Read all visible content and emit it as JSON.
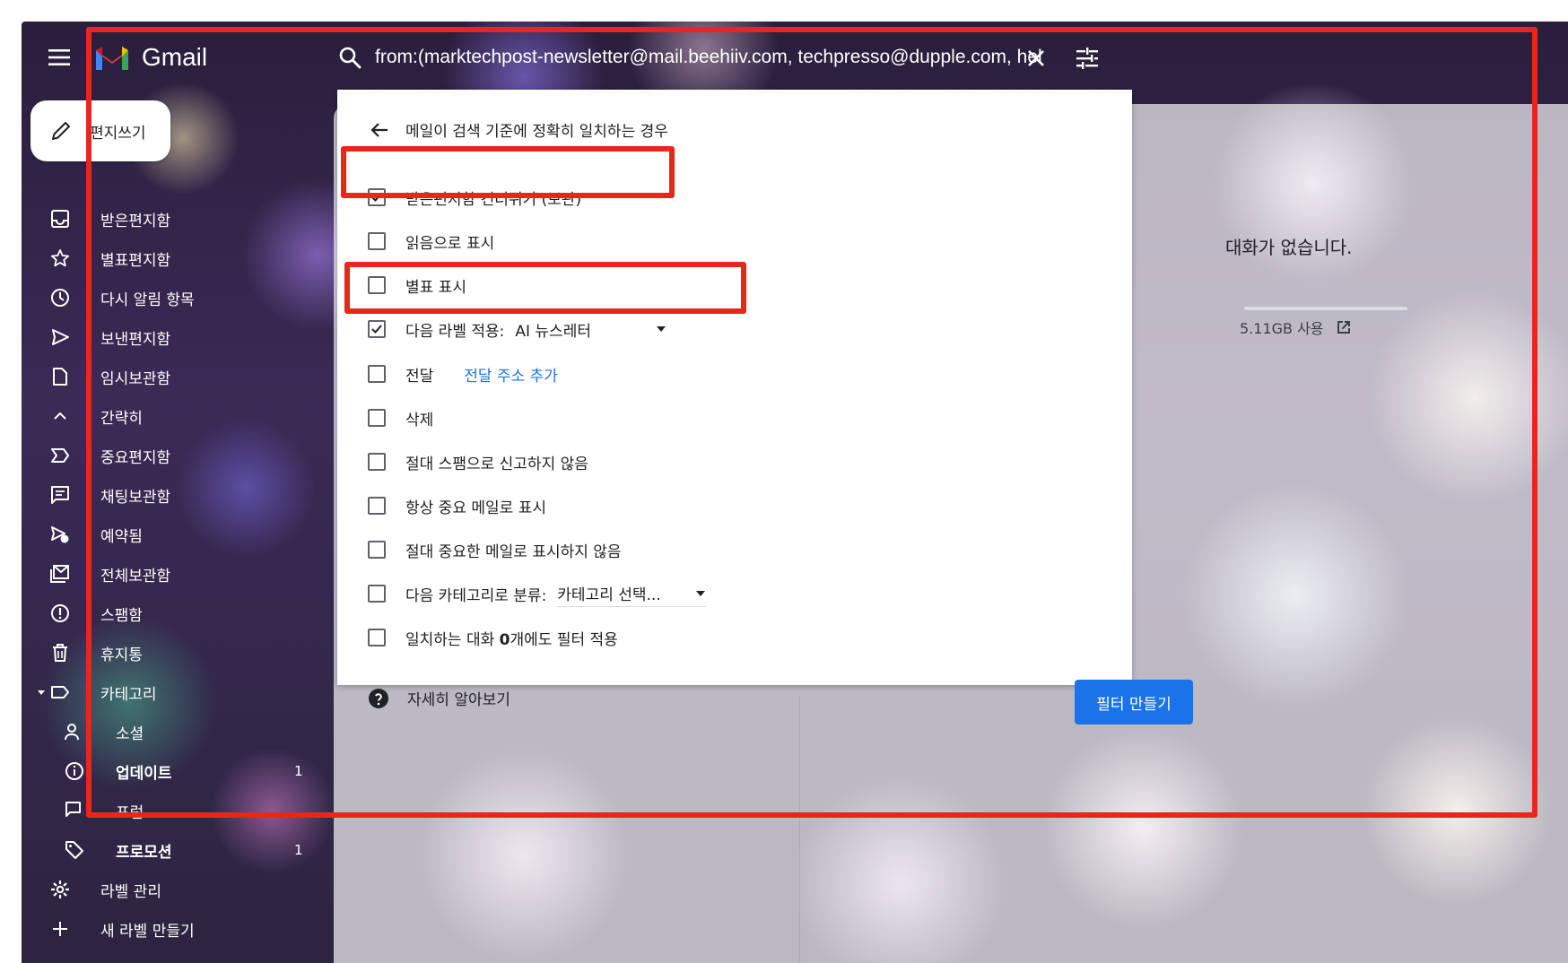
{
  "app": {
    "name": "Gmail",
    "search_query": "from:(marktechpost-newsletter@mail.beehiiv.com, techpresso@dupple.com, hel"
  },
  "compose": {
    "label": "편지쓰기"
  },
  "sidebar": {
    "items": [
      {
        "label": "받은편지함",
        "icon": "inbox-icon"
      },
      {
        "label": "별표편지함",
        "icon": "star-icon"
      },
      {
        "label": "다시 알림 항목",
        "icon": "clock-icon"
      },
      {
        "label": "보낸편지함",
        "icon": "send-icon"
      },
      {
        "label": "임시보관함",
        "icon": "draft-icon"
      },
      {
        "label": "간략히",
        "icon": "chevron-up-icon"
      },
      {
        "label": "중요편지함",
        "icon": "important-icon"
      },
      {
        "label": "채팅보관함",
        "icon": "chat-icon"
      },
      {
        "label": "예약됨",
        "icon": "scheduled-icon"
      },
      {
        "label": "전체보관함",
        "icon": "all-mail-icon"
      },
      {
        "label": "스팸함",
        "icon": "spam-icon"
      },
      {
        "label": "휴지통",
        "icon": "trash-icon"
      },
      {
        "label": "카테고리",
        "icon": "label-icon"
      },
      {
        "label": "소셜",
        "icon": "people-icon"
      },
      {
        "label": "업데이트",
        "icon": "info-icon",
        "count": "1"
      },
      {
        "label": "포럼",
        "icon": "forum-icon"
      },
      {
        "label": "프로모션",
        "icon": "tag-icon",
        "count": "1"
      },
      {
        "label": "라벨 관리",
        "icon": "gear-icon"
      },
      {
        "label": "새 라벨 만들기",
        "icon": "plus-icon"
      }
    ]
  },
  "main": {
    "empty_message": "대화가 없습니다.",
    "storage_text": "5.11GB 사용"
  },
  "filter_dialog": {
    "title": "메일이 검색 기준에 정확히 일치하는 경우",
    "options": [
      {
        "label": "받은편지함 건너뛰기 (보관)",
        "checked": true
      },
      {
        "label": "읽음으로 표시",
        "checked": false
      },
      {
        "label": "별표 표시",
        "checked": false
      },
      {
        "label": "다음 라벨 적용:",
        "checked": true,
        "select_value": "AI 뉴스레터"
      },
      {
        "label": "전달",
        "checked": false,
        "link": "전달 주소 추가"
      },
      {
        "label": "삭제",
        "checked": false
      },
      {
        "label": "절대 스팸으로 신고하지 않음",
        "checked": false
      },
      {
        "label": "항상 중요 메일로 표시",
        "checked": false
      },
      {
        "label": "절대 중요한 메일로 표시하지 않음",
        "checked": false
      },
      {
        "label": "다음 카테고리로 분류:",
        "checked": false,
        "select_value": "카테고리 선택..."
      },
      {
        "label_prefix": "일치하는 대화 ",
        "label_bold": "0",
        "label_suffix": "개에도 필터 적용",
        "checked": false
      }
    ],
    "help_label": "자세히 알아보기",
    "create_button": "필터 만들기"
  },
  "colors": {
    "accent": "#1a73e8",
    "annotation": "#e8261c"
  }
}
